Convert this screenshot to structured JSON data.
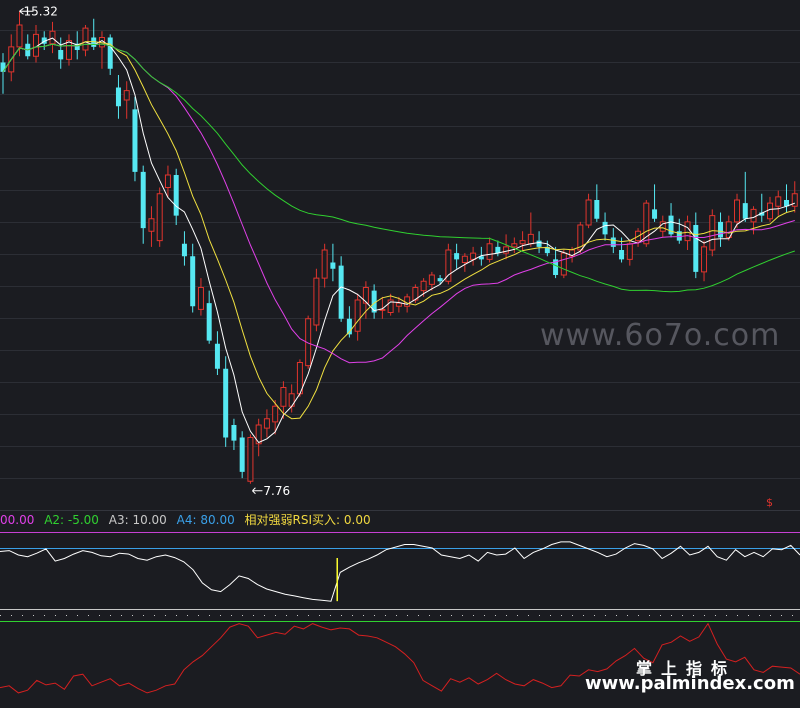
{
  "colors": {
    "background": "#1b1c21",
    "up_candle": "#e0342d",
    "down_candle": "#56e8f2",
    "ma_short": "#ffffff",
    "ma_mid": "#f0e040",
    "ma_long": "#e040e8",
    "ma_longer": "#30d030",
    "rsi_line": "#ffffff",
    "rsi_lower": "#d42020",
    "buy_signal": "#ffff30"
  },
  "watermarks": {
    "site_primary": "www.6o7o.com",
    "site_chinese": "掌上指标",
    "site_secondary": "www.palmindex.com",
    "corner_mark": "$"
  },
  "indicator_legend": [
    {
      "text": "00.00",
      "color": "#e040e8"
    },
    {
      "text": "A2: -5.00",
      "color": "#30d030"
    },
    {
      "text": "A3: 10.00",
      "color": "#c8c8c8"
    },
    {
      "text": "A4: 80.00",
      "color": "#3aa0e8"
    },
    {
      "text": "相对强弱RSI买入: 0.00",
      "color": "#f0d840"
    }
  ],
  "chart_data": [
    {
      "type": "candlestick",
      "annotations": {
        "high_label": "15.32",
        "low_label": "7.76",
        "high_value": 15.32,
        "low_value": 7.76
      },
      "ylim": [
        7.5,
        15.5
      ],
      "candles": [
        [
          14.5,
          14.65,
          14.0,
          14.35
        ],
        [
          14.35,
          14.95,
          14.2,
          14.75
        ],
        [
          14.75,
          15.32,
          14.6,
          15.1
        ],
        [
          14.8,
          14.95,
          14.55,
          14.6
        ],
        [
          14.6,
          15.1,
          14.5,
          14.95
        ],
        [
          14.9,
          15.0,
          14.7,
          14.8
        ],
        [
          14.8,
          15.15,
          14.65,
          15.0
        ],
        [
          14.7,
          14.9,
          14.4,
          14.55
        ],
        [
          14.55,
          14.95,
          14.45,
          14.85
        ],
        [
          14.8,
          15.0,
          14.55,
          14.7
        ],
        [
          14.7,
          15.1,
          14.6,
          15.05
        ],
        [
          14.9,
          15.2,
          14.7,
          14.75
        ],
        [
          14.75,
          15.0,
          14.4,
          14.9
        ],
        [
          14.9,
          14.95,
          14.3,
          14.4
        ],
        [
          14.1,
          14.3,
          13.6,
          13.8
        ],
        [
          13.9,
          14.2,
          13.6,
          14.05
        ],
        [
          13.75,
          13.95,
          12.6,
          12.75
        ],
        [
          12.75,
          12.85,
          11.6,
          11.85
        ],
        [
          11.8,
          12.2,
          11.55,
          12.0
        ],
        [
          11.65,
          12.5,
          11.55,
          12.4
        ],
        [
          12.5,
          12.85,
          12.35,
          12.7
        ],
        [
          12.7,
          12.8,
          11.9,
          12.05
        ],
        [
          11.6,
          11.8,
          11.25,
          11.4
        ],
        [
          11.4,
          11.6,
          10.5,
          10.6
        ],
        [
          10.55,
          11.05,
          10.45,
          10.9
        ],
        [
          10.65,
          10.85,
          10.0,
          10.05
        ],
        [
          10.0,
          10.2,
          9.5,
          9.6
        ],
        [
          9.6,
          9.8,
          8.35,
          8.5
        ],
        [
          8.7,
          8.8,
          8.3,
          8.45
        ],
        [
          8.5,
          8.6,
          7.85,
          7.95
        ],
        [
          7.8,
          8.55,
          7.76,
          8.5
        ],
        [
          8.4,
          8.8,
          8.2,
          8.7
        ],
        [
          8.65,
          8.95,
          8.5,
          8.8
        ],
        [
          8.75,
          9.1,
          8.55,
          9.0
        ],
        [
          9.0,
          9.4,
          8.8,
          9.3
        ],
        [
          9.0,
          9.35,
          8.9,
          9.2
        ],
        [
          9.2,
          9.75,
          9.15,
          9.7
        ],
        [
          9.65,
          10.45,
          9.6,
          10.4
        ],
        [
          10.3,
          11.2,
          10.2,
          11.05
        ],
        [
          11.05,
          11.6,
          10.9,
          11.5
        ],
        [
          11.3,
          11.6,
          11.0,
          11.2
        ],
        [
          11.25,
          11.4,
          10.35,
          10.4
        ],
        [
          10.4,
          10.6,
          10.1,
          10.15
        ],
        [
          10.2,
          10.8,
          10.05,
          10.7
        ],
        [
          10.65,
          11.0,
          10.4,
          10.9
        ],
        [
          10.85,
          10.95,
          10.4,
          10.5
        ],
        [
          10.55,
          10.75,
          10.4,
          10.55
        ],
        [
          10.5,
          10.8,
          10.45,
          10.7
        ],
        [
          10.6,
          10.75,
          10.5,
          10.65
        ],
        [
          10.6,
          10.8,
          10.5,
          10.75
        ],
        [
          10.7,
          10.95,
          10.65,
          10.9
        ],
        [
          10.85,
          11.05,
          10.75,
          11.0
        ],
        [
          10.95,
          11.15,
          10.85,
          11.1
        ],
        [
          11.05,
          11.1,
          10.95,
          11.0
        ],
        [
          11.0,
          11.6,
          10.95,
          11.5
        ],
        [
          11.45,
          11.6,
          11.2,
          11.35
        ],
        [
          11.3,
          11.45,
          11.15,
          11.4
        ],
        [
          11.35,
          11.55,
          11.25,
          11.45
        ],
        [
          11.4,
          11.55,
          11.25,
          11.35
        ],
        [
          11.35,
          11.7,
          11.3,
          11.6
        ],
        [
          11.55,
          11.65,
          11.4,
          11.45
        ],
        [
          11.45,
          11.75,
          11.35,
          11.55
        ],
        [
          11.55,
          11.7,
          11.45,
          11.6
        ],
        [
          11.6,
          11.8,
          11.5,
          11.65
        ],
        [
          11.6,
          12.1,
          11.55,
          11.75
        ],
        [
          11.65,
          11.8,
          11.45,
          11.55
        ],
        [
          11.55,
          11.65,
          11.4,
          11.45
        ],
        [
          11.35,
          11.55,
          11.05,
          11.1
        ],
        [
          11.1,
          11.5,
          11.05,
          11.45
        ],
        [
          11.4,
          11.55,
          11.3,
          11.5
        ],
        [
          11.5,
          11.95,
          11.45,
          11.9
        ],
        [
          11.9,
          12.4,
          11.85,
          12.3
        ],
        [
          12.3,
          12.55,
          11.95,
          12.0
        ],
        [
          11.95,
          12.1,
          11.65,
          11.75
        ],
        [
          11.7,
          11.85,
          11.45,
          11.55
        ],
        [
          11.5,
          11.7,
          11.3,
          11.35
        ],
        [
          11.35,
          11.65,
          11.25,
          11.6
        ],
        [
          11.65,
          11.85,
          11.55,
          11.8
        ],
        [
          11.6,
          12.3,
          11.55,
          12.25
        ],
        [
          12.15,
          12.55,
          11.95,
          12.0
        ],
        [
          11.8,
          12.05,
          11.7,
          11.95
        ],
        [
          12.05,
          12.25,
          11.7,
          11.75
        ],
        [
          11.8,
          12.0,
          11.6,
          11.65
        ],
        [
          11.65,
          12.05,
          11.5,
          11.95
        ],
        [
          11.9,
          12.1,
          11.05,
          11.15
        ],
        [
          11.15,
          11.65,
          11.0,
          11.55
        ],
        [
          11.5,
          12.15,
          11.4,
          12.05
        ],
        [
          11.95,
          12.1,
          11.55,
          11.7
        ],
        [
          11.7,
          12.05,
          11.65,
          11.95
        ],
        [
          11.95,
          12.4,
          11.85,
          12.3
        ],
        [
          12.25,
          12.75,
          11.95,
          12.0
        ],
        [
          11.95,
          12.2,
          11.75,
          12.15
        ],
        [
          12.1,
          12.4,
          11.95,
          12.05
        ],
        [
          12.0,
          12.35,
          11.95,
          12.25
        ],
        [
          12.2,
          12.45,
          12.05,
          12.35
        ],
        [
          12.3,
          12.55,
          12.1,
          12.2
        ],
        [
          12.2,
          12.6,
          12.1,
          12.4
        ]
      ]
    },
    {
      "type": "line",
      "indicator": "RSI",
      "ylim": [
        0,
        100
      ],
      "reference_levels": [
        80,
        10,
        -5
      ],
      "series": [
        {
          "color": "#ffffff",
          "values": [
            76,
            77,
            72,
            70,
            74,
            79,
            65,
            68,
            73,
            77,
            75,
            71,
            70,
            74,
            73,
            68,
            66,
            70,
            72,
            69,
            64,
            55,
            40,
            32,
            30,
            38,
            48,
            45,
            38,
            33,
            30,
            27,
            25,
            23,
            21,
            20,
            19,
            52,
            58,
            63,
            67,
            72,
            78,
            81,
            84,
            84,
            82,
            80,
            72,
            70,
            68,
            72,
            65,
            75,
            72,
            73,
            80,
            68,
            75,
            79,
            84,
            87,
            87,
            83,
            79,
            75,
            70,
            73,
            80,
            85,
            83,
            79,
            68,
            74,
            82,
            72,
            75,
            82,
            70,
            66,
            78,
            70,
            75,
            70,
            79,
            78,
            83,
            72
          ]
        },
        {
          "color": "#d42020",
          "values": [
            14,
            16,
            8,
            11,
            22,
            17,
            19,
            12,
            27,
            29,
            16,
            20,
            24,
            16,
            19,
            13,
            8,
            11,
            16,
            18,
            34,
            43,
            50,
            60,
            70,
            82,
            86,
            83,
            70,
            73,
            76,
            74,
            83,
            80,
            86,
            82,
            79,
            81,
            80,
            73,
            72,
            70,
            65,
            60,
            52,
            42,
            22,
            16,
            10,
            24,
            20,
            25,
            18,
            23,
            30,
            23,
            18,
            16,
            23,
            19,
            14,
            16,
            28,
            27,
            34,
            32,
            35,
            44,
            50,
            58,
            47,
            42,
            62,
            65,
            72,
            66,
            71,
            86,
            63,
            46,
            43,
            48,
            34,
            31,
            38,
            37,
            36,
            29
          ]
        }
      ],
      "buy_signal": {
        "index": 37
      }
    }
  ]
}
